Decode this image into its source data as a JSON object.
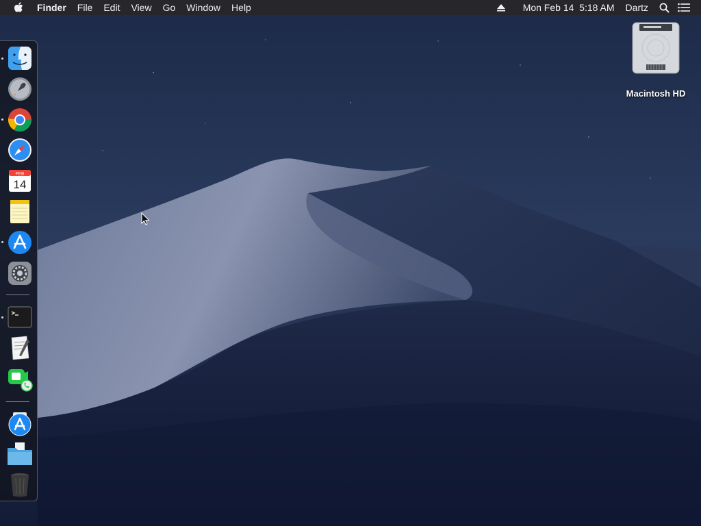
{
  "menubar": {
    "app_name": "Finder",
    "menus": [
      "File",
      "Edit",
      "View",
      "Go",
      "Window",
      "Help"
    ],
    "status": {
      "eject_icon": "eject-icon",
      "datetime": "Mon Feb 14  5:18 AM",
      "user": "Dartz",
      "search_icon": "spotlight-search-icon",
      "notification_icon": "notification-center-icon"
    }
  },
  "dock": {
    "items": [
      {
        "name": "Finder",
        "icon": "finder-icon",
        "running": true
      },
      {
        "name": "Launchpad",
        "icon": "launchpad-icon",
        "running": false
      },
      {
        "name": "Google Chrome",
        "icon": "chrome-icon",
        "running": true
      },
      {
        "name": "Safari",
        "icon": "safari-icon",
        "running": false
      },
      {
        "name": "Calendar",
        "icon": "calendar-icon",
        "running": false,
        "month": "FEB",
        "day": "14"
      },
      {
        "name": "Notes",
        "icon": "notes-icon",
        "running": false
      },
      {
        "name": "App Store",
        "icon": "app-store-icon",
        "running": true
      },
      {
        "name": "System Preferences",
        "icon": "system-preferences-icon",
        "running": false
      },
      {
        "name": "Terminal",
        "icon": "terminal-icon",
        "running": true
      },
      {
        "name": "TextEdit",
        "icon": "textedit-icon",
        "running": false
      },
      {
        "name": "FaceTime",
        "icon": "facetime-icon",
        "running": false
      },
      {
        "name": "App Store Downloads",
        "icon": "app-store-icon",
        "running": false
      },
      {
        "name": "Documents",
        "icon": "folder-icon",
        "running": false
      },
      {
        "name": "Trash",
        "icon": "trash-icon",
        "running": false
      }
    ]
  },
  "desktop": {
    "icons": [
      {
        "label": "Macintosh HD",
        "icon": "hard-drive-icon"
      }
    ]
  },
  "colors": {
    "menubar_bg": "#26262a",
    "sky_top": "#1c2a4a",
    "sky_bottom": "#0f1730",
    "dune_highlight": "#7a86a6"
  }
}
